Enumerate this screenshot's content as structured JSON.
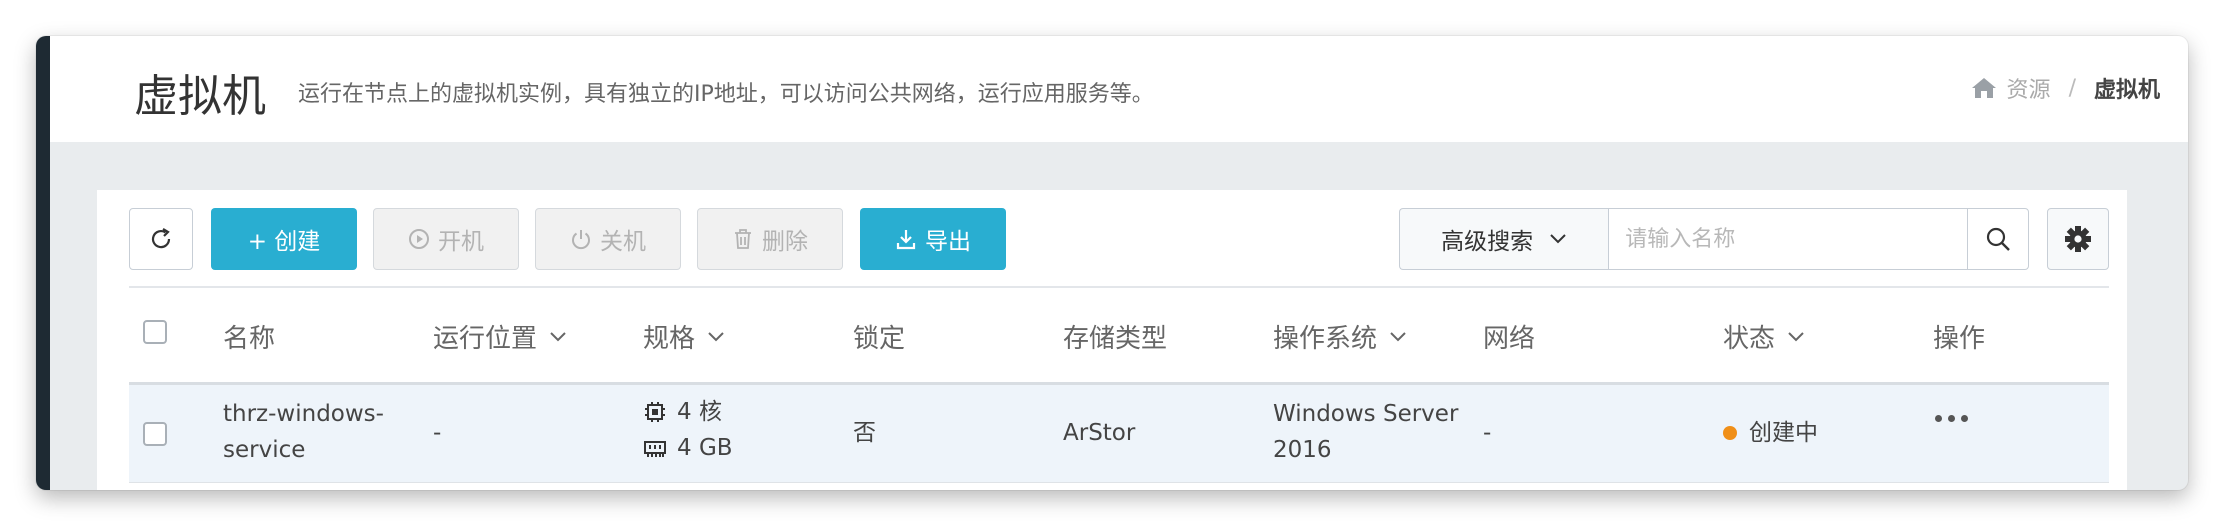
{
  "header": {
    "title": "虚拟机",
    "subtitle": "运行在节点上的虚拟机实例，具有独立的IP地址，可以访问公共网络，运行应用服务等。",
    "breadcrumb": {
      "parent": "资源",
      "separator": "/",
      "current": "虚拟机"
    }
  },
  "toolbar": {
    "create": "+ 创建",
    "start": "开机",
    "stop": "关机",
    "delete": "删除",
    "export": "导出"
  },
  "search": {
    "advanced": "高级搜索",
    "placeholder": "请输入名称"
  },
  "table": {
    "columns": [
      "名称",
      "运行位置",
      "规格",
      "锁定",
      "存储类型",
      "操作系统",
      "网络",
      "状态",
      "操作"
    ],
    "rows": [
      {
        "name_line1": "thrz-windows-",
        "name_line2": "service",
        "location": "-",
        "cpu": "4 核",
        "memory": "4 GB",
        "locked": "否",
        "storage": "ArStor",
        "os_line1": "Windows Server",
        "os_line2": "2016",
        "network": "-",
        "status": "创建中",
        "status_color": "#f08f18"
      }
    ]
  },
  "colors": {
    "accent": "#29aed1",
    "sidebar": "#1e2a33"
  }
}
